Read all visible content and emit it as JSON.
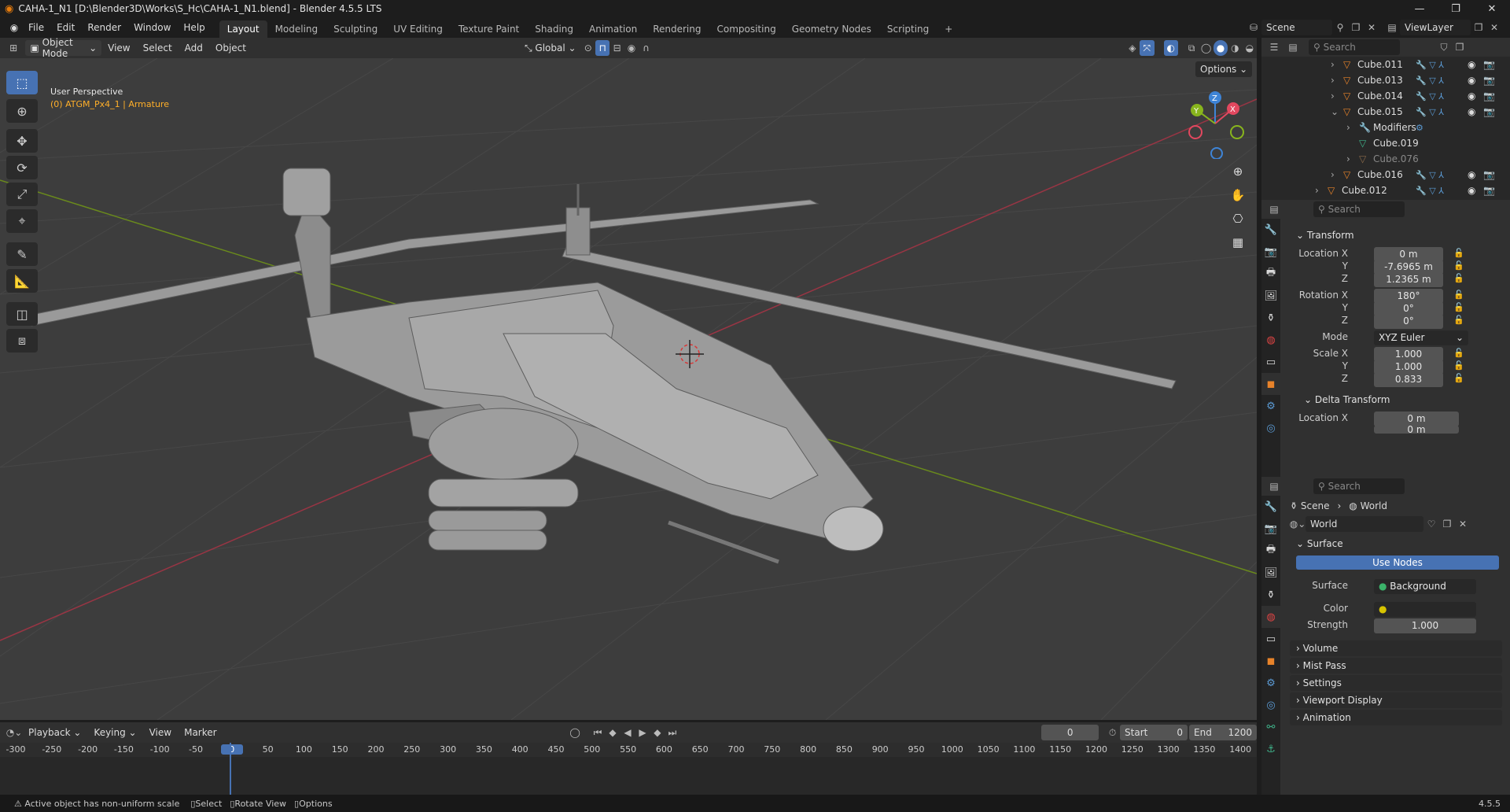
{
  "window": {
    "title": "CAHA-1_N1 [D:\\Blender3D\\Works\\S_Hc\\CAHA-1_N1.blend] - Blender 4.5.5 LTS",
    "minimize": "—",
    "maximize": "❐",
    "close": "✕"
  },
  "menu": [
    "File",
    "Edit",
    "Render",
    "Window",
    "Help"
  ],
  "workspaces": [
    "Layout",
    "Modeling",
    "Sculpting",
    "UV Editing",
    "Texture Paint",
    "Shading",
    "Animation",
    "Rendering",
    "Compositing",
    "Geometry Nodes",
    "Scripting"
  ],
  "workspace_add": "+",
  "scene": {
    "name": "Scene",
    "viewlayer": "ViewLayer"
  },
  "viewport_header": {
    "mode": "Object Mode",
    "menus": [
      "View",
      "Select",
      "Add",
      "Object"
    ],
    "transform_orientation": "Global",
    "options": "Options"
  },
  "viewport": {
    "perspective": "User Perspective",
    "active": "(0) ATGM_Px4_1 | Armature",
    "gizmo": {
      "x": "X",
      "y": "Y",
      "z": "Z"
    }
  },
  "outliner": {
    "search": "Search",
    "rows": [
      {
        "name": "Cube.011",
        "indent": 0,
        "expand": "›",
        "kind": "mesh",
        "eye": true
      },
      {
        "name": "Cube.013",
        "indent": 0,
        "expand": "›",
        "kind": "mesh",
        "eye": true
      },
      {
        "name": "Cube.014",
        "indent": 0,
        "expand": "›",
        "kind": "mesh",
        "eye": true
      },
      {
        "name": "Cube.015",
        "indent": 0,
        "expand": "⌄",
        "kind": "mesh",
        "eye": true
      },
      {
        "name": "Modifiers",
        "indent": 1,
        "expand": "›",
        "kind": "wrench",
        "eye": false
      },
      {
        "name": "Cube.019",
        "indent": 1,
        "expand": "",
        "kind": "data",
        "eye": false
      },
      {
        "name": "Cube.076",
        "indent": 1,
        "expand": "›",
        "kind": "mesh-dim",
        "eye": false
      },
      {
        "name": "Cube.016",
        "indent": 0,
        "expand": "›",
        "kind": "mesh",
        "eye": true
      },
      {
        "name": "Cube.012",
        "indent": -1,
        "expand": "›",
        "kind": "mesh",
        "eye": true
      }
    ]
  },
  "object_props": {
    "search": "Search",
    "transform": "Transform",
    "location_label": "Location X",
    "loc": [
      "0 m",
      "-7.6965 m",
      "1.2365 m"
    ],
    "rotation_label": "Rotation X",
    "rot": [
      "180°",
      "0°",
      "0°"
    ],
    "mode_label": "Mode",
    "mode": "XYZ Euler",
    "scale_label": "Scale X",
    "scale": [
      "1.000",
      "1.000",
      "0.833"
    ],
    "axis_y": "Y",
    "axis_z": "Z",
    "delta": "Delta Transform",
    "delta_loc": "0 m",
    "delta_loc2": "0 m"
  },
  "world_props": {
    "search": "Search",
    "breadcrumb": [
      "Scene",
      "World"
    ],
    "world_name": "World",
    "surface_section": "Surface",
    "use_nodes": "Use Nodes",
    "surface_label": "Surface",
    "surface_value": "Background",
    "color_label": "Color",
    "strength_label": "Strength",
    "strength": "1.000",
    "sections": [
      "Volume",
      "Mist Pass",
      "Settings",
      "Viewport Display",
      "Animation"
    ]
  },
  "timeline": {
    "menus": [
      "Playback",
      "Keying",
      "View",
      "Marker"
    ],
    "current_frame": "0",
    "start_label": "Start",
    "start": "0",
    "end_label": "End",
    "end": "1200",
    "ruler": [
      "-300",
      "-250",
      "-200",
      "-150",
      "-100",
      "-50",
      "0",
      "50",
      "100",
      "150",
      "200",
      "250",
      "300",
      "350",
      "400",
      "450",
      "500",
      "550",
      "600",
      "650",
      "700",
      "750",
      "800",
      "850",
      "900",
      "950",
      "1000",
      "1050",
      "1100",
      "1150",
      "1200",
      "1250",
      "1300",
      "1350",
      "1400"
    ]
  },
  "status": {
    "warning": "Active object has non-uniform scale",
    "select": "Select",
    "rotate": "Rotate View",
    "options": "Options",
    "version": "4.5.5"
  },
  "colors": {
    "accent": "#4772b3",
    "active_obj": "#ffaf29",
    "x_axis": "#e2485f",
    "y_axis": "#88b51d",
    "z_axis": "#3e84d6"
  }
}
